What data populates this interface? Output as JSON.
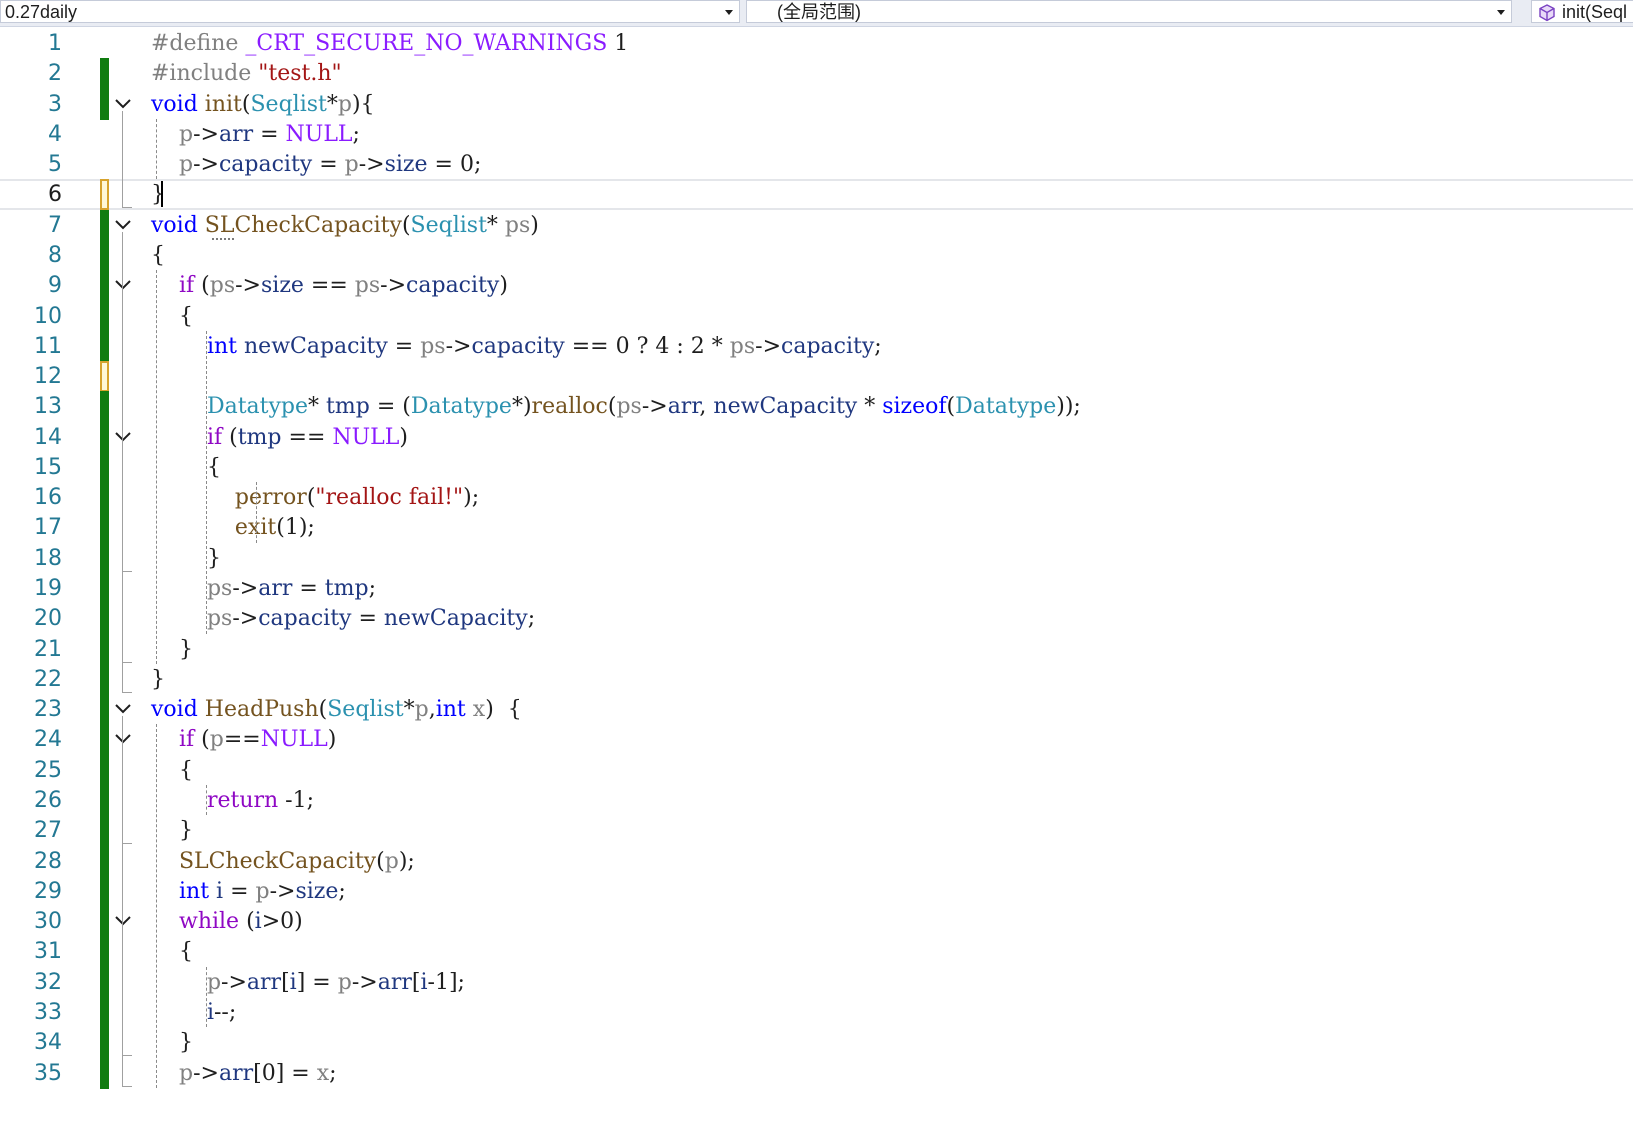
{
  "navbar": {
    "project": "0.27daily",
    "scope": "(全局范围)",
    "member": "init(Seql"
  },
  "colors": {
    "keyword": "#0000ff",
    "control": "#8f08c4",
    "type": "#2b91af",
    "function": "#74531f",
    "parameter": "#808080",
    "variable": "#1f377f",
    "string": "#a31515",
    "macro": "#8a1bff",
    "preprocessor": "#808080",
    "number": "#1e1e1e",
    "operator": "#1e1e1e",
    "change_saved": "#107c10",
    "change_unsaved": "#d7a32d",
    "line_number": "#237893"
  },
  "editor": {
    "current_line": 6,
    "lines": [
      {
        "n": "1",
        "change": "none",
        "fold": false,
        "tokens": [
          [
            "#define ",
            "pre"
          ],
          [
            "_CRT_SECURE_NO_WARNINGS",
            "mac"
          ],
          [
            " 1",
            "num"
          ]
        ]
      },
      {
        "n": "2",
        "change": "saved",
        "fold": false,
        "tokens": [
          [
            "#include ",
            "pre"
          ],
          [
            "\"test.h\"",
            "str"
          ]
        ]
      },
      {
        "n": "3",
        "change": "saved",
        "fold": true,
        "tokens": [
          [
            "void",
            "kw"
          ],
          [
            " ",
            ""
          ],
          [
            "init",
            "fn"
          ],
          [
            "(",
            ""
          ],
          [
            "Seqlist",
            "ty"
          ],
          [
            "*",
            ""
          ],
          [
            "p",
            "par"
          ],
          [
            "){",
            ""
          ]
        ]
      },
      {
        "n": "4",
        "change": "none",
        "fold": false,
        "tokens": [
          [
            "    ",
            ""
          ],
          [
            "p",
            "par"
          ],
          [
            "->",
            ""
          ],
          [
            "arr",
            "var"
          ],
          [
            " = ",
            ""
          ],
          [
            "NULL",
            "mac"
          ],
          [
            ";",
            ""
          ]
        ]
      },
      {
        "n": "5",
        "change": "none",
        "fold": false,
        "tokens": [
          [
            "    ",
            ""
          ],
          [
            "p",
            "par"
          ],
          [
            "->",
            ""
          ],
          [
            "capacity",
            "var"
          ],
          [
            " = ",
            ""
          ],
          [
            "p",
            "par"
          ],
          [
            "->",
            ""
          ],
          [
            "size",
            "var"
          ],
          [
            " = ",
            ""
          ],
          [
            "0",
            "num"
          ],
          [
            ";",
            ""
          ]
        ]
      },
      {
        "n": "6",
        "change": "unsaved",
        "fold": false,
        "tokens": [
          [
            "}",
            ""
          ]
        ]
      },
      {
        "n": "7",
        "change": "saved",
        "fold": true,
        "tokens": [
          [
            "void",
            "kw"
          ],
          [
            " ",
            ""
          ],
          [
            "SLCheckCapacity",
            "fn"
          ],
          [
            "(",
            ""
          ],
          [
            "Seqlist",
            "ty"
          ],
          [
            "* ",
            ""
          ],
          [
            "ps",
            "par"
          ],
          [
            ")",
            ""
          ]
        ]
      },
      {
        "n": "8",
        "change": "saved",
        "fold": false,
        "tokens": [
          [
            "{",
            ""
          ]
        ]
      },
      {
        "n": "9",
        "change": "saved",
        "fold": true,
        "tokens": [
          [
            "    ",
            ""
          ],
          [
            "if",
            "ctl"
          ],
          [
            " (",
            ""
          ],
          [
            "ps",
            "par"
          ],
          [
            "->",
            ""
          ],
          [
            "size",
            "var"
          ],
          [
            " == ",
            ""
          ],
          [
            "ps",
            "par"
          ],
          [
            "->",
            ""
          ],
          [
            "capacity",
            "var"
          ],
          [
            ")",
            ""
          ]
        ]
      },
      {
        "n": "10",
        "change": "saved",
        "fold": false,
        "tokens": [
          [
            "    {",
            ""
          ]
        ]
      },
      {
        "n": "11",
        "change": "saved",
        "fold": false,
        "tokens": [
          [
            "        ",
            ""
          ],
          [
            "int",
            "kw"
          ],
          [
            " ",
            ""
          ],
          [
            "newCapacity",
            "var"
          ],
          [
            " = ",
            ""
          ],
          [
            "ps",
            "par"
          ],
          [
            "->",
            ""
          ],
          [
            "capacity",
            "var"
          ],
          [
            " == ",
            ""
          ],
          [
            "0",
            "num"
          ],
          [
            " ? ",
            ""
          ],
          [
            "4",
            "num"
          ],
          [
            " : ",
            ""
          ],
          [
            "2",
            "num"
          ],
          [
            " * ",
            ""
          ],
          [
            "ps",
            "par"
          ],
          [
            "->",
            ""
          ],
          [
            "capacity",
            "var"
          ],
          [
            ";",
            ""
          ]
        ]
      },
      {
        "n": "12",
        "change": "unsaved",
        "fold": false,
        "tokens": []
      },
      {
        "n": "13",
        "change": "saved",
        "fold": false,
        "tokens": [
          [
            "        ",
            ""
          ],
          [
            "Datatype",
            "ty"
          ],
          [
            "* ",
            ""
          ],
          [
            "tmp",
            "var"
          ],
          [
            " = (",
            ""
          ],
          [
            "Datatype",
            "ty"
          ],
          [
            "*)",
            ""
          ],
          [
            "realloc",
            "fn"
          ],
          [
            "(",
            ""
          ],
          [
            "ps",
            "par"
          ],
          [
            "->",
            ""
          ],
          [
            "arr",
            "var"
          ],
          [
            ", ",
            ""
          ],
          [
            "newCapacity",
            "var"
          ],
          [
            " * ",
            ""
          ],
          [
            "sizeof",
            "kw"
          ],
          [
            "(",
            ""
          ],
          [
            "Datatype",
            "ty"
          ],
          [
            "));",
            ""
          ]
        ]
      },
      {
        "n": "14",
        "change": "saved",
        "fold": true,
        "tokens": [
          [
            "        ",
            ""
          ],
          [
            "if",
            "ctl"
          ],
          [
            " (",
            ""
          ],
          [
            "tmp",
            "var"
          ],
          [
            " == ",
            ""
          ],
          [
            "NULL",
            "mac"
          ],
          [
            ")",
            ""
          ]
        ]
      },
      {
        "n": "15",
        "change": "saved",
        "fold": false,
        "tokens": [
          [
            "        {",
            ""
          ]
        ]
      },
      {
        "n": "16",
        "change": "saved",
        "fold": false,
        "tokens": [
          [
            "            ",
            ""
          ],
          [
            "perror",
            "fn"
          ],
          [
            "(",
            ""
          ],
          [
            "\"realloc fail!\"",
            "str"
          ],
          [
            ");",
            ""
          ]
        ]
      },
      {
        "n": "17",
        "change": "saved",
        "fold": false,
        "tokens": [
          [
            "            ",
            ""
          ],
          [
            "exit",
            "fn"
          ],
          [
            "(",
            ""
          ],
          [
            "1",
            "num"
          ],
          [
            ");",
            ""
          ]
        ]
      },
      {
        "n": "18",
        "change": "saved",
        "fold": false,
        "tokens": [
          [
            "        }",
            ""
          ]
        ]
      },
      {
        "n": "19",
        "change": "saved",
        "fold": false,
        "tokens": [
          [
            "        ",
            ""
          ],
          [
            "ps",
            "par"
          ],
          [
            "->",
            ""
          ],
          [
            "arr",
            "var"
          ],
          [
            " = ",
            ""
          ],
          [
            "tmp",
            "var"
          ],
          [
            ";",
            ""
          ]
        ]
      },
      {
        "n": "20",
        "change": "saved",
        "fold": false,
        "tokens": [
          [
            "        ",
            ""
          ],
          [
            "ps",
            "par"
          ],
          [
            "->",
            ""
          ],
          [
            "capacity",
            "var"
          ],
          [
            " = ",
            ""
          ],
          [
            "newCapacity",
            "var"
          ],
          [
            ";",
            ""
          ]
        ]
      },
      {
        "n": "21",
        "change": "saved",
        "fold": false,
        "tokens": [
          [
            "    }",
            ""
          ]
        ]
      },
      {
        "n": "22",
        "change": "saved",
        "fold": false,
        "tokens": [
          [
            "}",
            ""
          ]
        ]
      },
      {
        "n": "23",
        "change": "saved",
        "fold": true,
        "tokens": [
          [
            "void",
            "kw"
          ],
          [
            " ",
            ""
          ],
          [
            "HeadPush",
            "fn"
          ],
          [
            "(",
            ""
          ],
          [
            "Seqlist",
            "ty"
          ],
          [
            "*",
            ""
          ],
          [
            "p",
            "par"
          ],
          [
            ",",
            ""
          ],
          [
            "int",
            "kw"
          ],
          [
            " ",
            ""
          ],
          [
            "x",
            "par"
          ],
          [
            ")  {",
            ""
          ]
        ]
      },
      {
        "n": "24",
        "change": "saved",
        "fold": true,
        "tokens": [
          [
            "    ",
            ""
          ],
          [
            "if",
            "ctl"
          ],
          [
            " (",
            ""
          ],
          [
            "p",
            "par"
          ],
          [
            "==",
            ""
          ],
          [
            "NULL",
            "mac"
          ],
          [
            ")",
            ""
          ]
        ]
      },
      {
        "n": "25",
        "change": "saved",
        "fold": false,
        "tokens": [
          [
            "    {",
            ""
          ]
        ]
      },
      {
        "n": "26",
        "change": "saved",
        "fold": false,
        "tokens": [
          [
            "        ",
            ""
          ],
          [
            "return",
            "ctl"
          ],
          [
            " -",
            ""
          ],
          [
            "1",
            "num"
          ],
          [
            ";",
            ""
          ]
        ]
      },
      {
        "n": "27",
        "change": "saved",
        "fold": false,
        "tokens": [
          [
            "    }",
            ""
          ]
        ]
      },
      {
        "n": "28",
        "change": "saved",
        "fold": false,
        "tokens": [
          [
            "    ",
            ""
          ],
          [
            "SLCheckCapacity",
            "fn"
          ],
          [
            "(",
            ""
          ],
          [
            "p",
            "par"
          ],
          [
            ");",
            ""
          ]
        ]
      },
      {
        "n": "29",
        "change": "saved",
        "fold": false,
        "tokens": [
          [
            "    ",
            ""
          ],
          [
            "int",
            "kw"
          ],
          [
            " ",
            ""
          ],
          [
            "i",
            "var"
          ],
          [
            " = ",
            ""
          ],
          [
            "p",
            "par"
          ],
          [
            "->",
            ""
          ],
          [
            "size",
            "var"
          ],
          [
            ";",
            ""
          ]
        ]
      },
      {
        "n": "30",
        "change": "saved",
        "fold": true,
        "tokens": [
          [
            "    ",
            ""
          ],
          [
            "while",
            "ctl"
          ],
          [
            " (",
            ""
          ],
          [
            "i",
            "var"
          ],
          [
            ">",
            ""
          ],
          [
            "0",
            "num"
          ],
          [
            ")",
            ""
          ]
        ]
      },
      {
        "n": "31",
        "change": "saved",
        "fold": false,
        "tokens": [
          [
            "    {",
            ""
          ]
        ]
      },
      {
        "n": "32",
        "change": "saved",
        "fold": false,
        "tokens": [
          [
            "        ",
            ""
          ],
          [
            "p",
            "par"
          ],
          [
            "->",
            ""
          ],
          [
            "arr",
            "var"
          ],
          [
            "[",
            ""
          ],
          [
            "i",
            "var"
          ],
          [
            "] = ",
            ""
          ],
          [
            "p",
            "par"
          ],
          [
            "->",
            ""
          ],
          [
            "arr",
            "var"
          ],
          [
            "[",
            ""
          ],
          [
            "i",
            "var"
          ],
          [
            "-",
            ""
          ],
          [
            "1",
            "num"
          ],
          [
            "];",
            ""
          ]
        ]
      },
      {
        "n": "33",
        "change": "saved",
        "fold": false,
        "tokens": [
          [
            "        ",
            ""
          ],
          [
            "i",
            "var"
          ],
          [
            "--;",
            ""
          ]
        ]
      },
      {
        "n": "34",
        "change": "saved",
        "fold": false,
        "tokens": [
          [
            "    }",
            ""
          ]
        ]
      },
      {
        "n": "35",
        "change": "saved",
        "fold": false,
        "tokens": [
          [
            "    ",
            ""
          ],
          [
            "p",
            "par"
          ],
          [
            "->",
            ""
          ],
          [
            "arr",
            "var"
          ],
          [
            "[",
            ""
          ],
          [
            "0",
            "num"
          ],
          [
            "] = ",
            ""
          ],
          [
            "x",
            "par"
          ],
          [
            ";",
            ""
          ]
        ]
      }
    ]
  }
}
